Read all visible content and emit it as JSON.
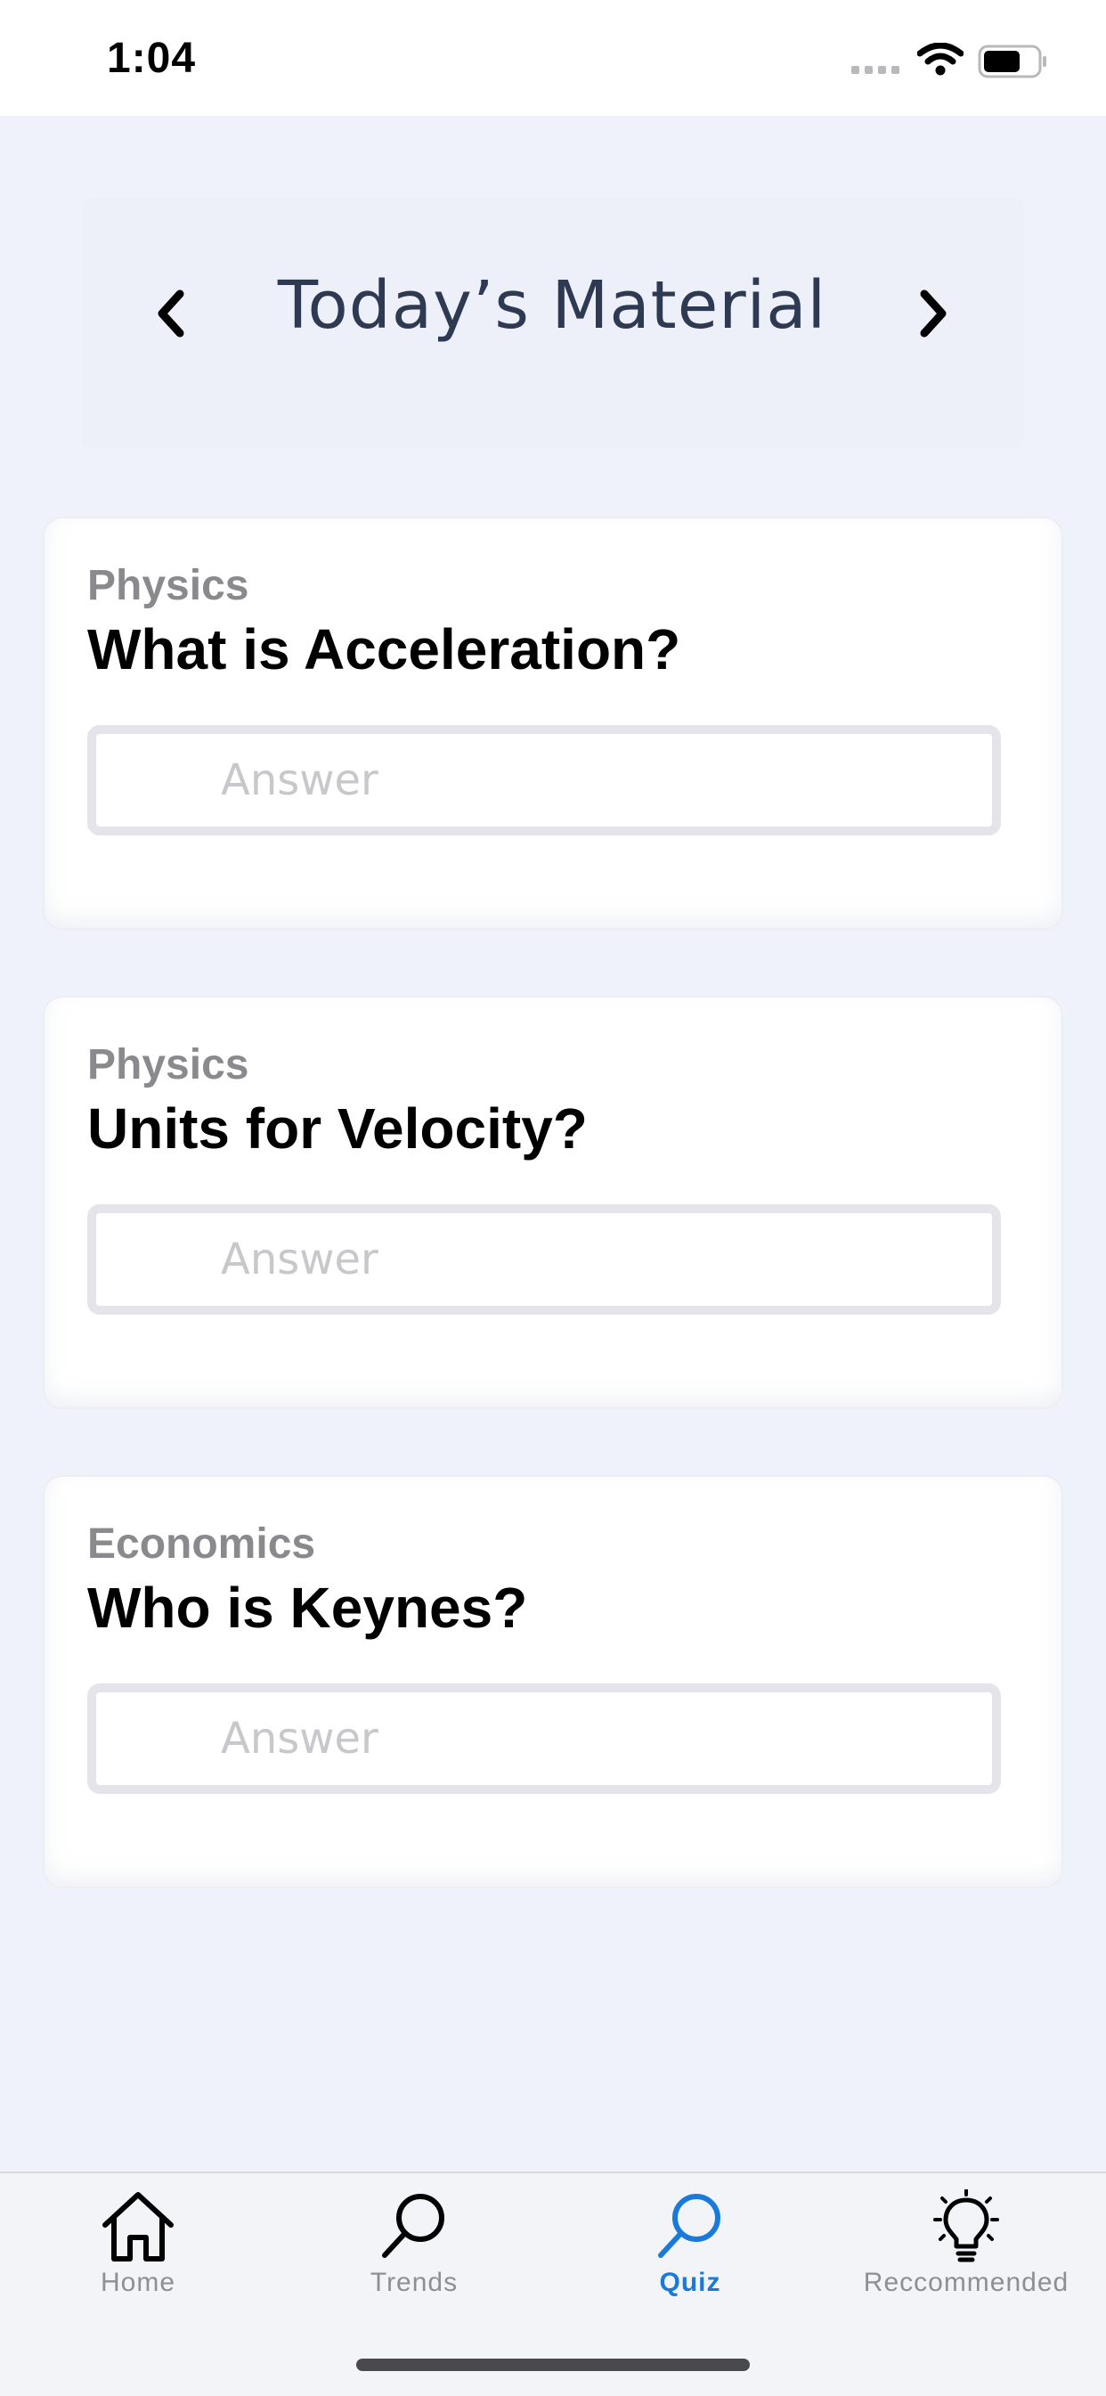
{
  "status_bar": {
    "time": "1:04"
  },
  "header": {
    "title": "Today’s Material",
    "prev_icon": "chevron-left-icon",
    "next_icon": "chevron-right-icon"
  },
  "quiz": {
    "cards": [
      {
        "subject": "Physics",
        "question": "What is Acceleration?",
        "answer_placeholder": "Answer",
        "answer_value": ""
      },
      {
        "subject": "Physics",
        "question": "Units for Velocity?",
        "answer_placeholder": "Answer",
        "answer_value": ""
      },
      {
        "subject": "Economics",
        "question": "Who is Keynes?",
        "answer_placeholder": "Answer",
        "answer_value": ""
      }
    ]
  },
  "tab_bar": {
    "active_color": "#1a7ad9",
    "inactive_color": "#8e8e93",
    "tabs": [
      {
        "label": "Home",
        "icon": "home-icon",
        "active": false
      },
      {
        "label": "Trends",
        "icon": "search-icon",
        "active": false
      },
      {
        "label": "Quiz",
        "icon": "search-icon",
        "active": true
      },
      {
        "label": "Reccommended",
        "icon": "lightbulb-icon",
        "active": false
      }
    ]
  }
}
